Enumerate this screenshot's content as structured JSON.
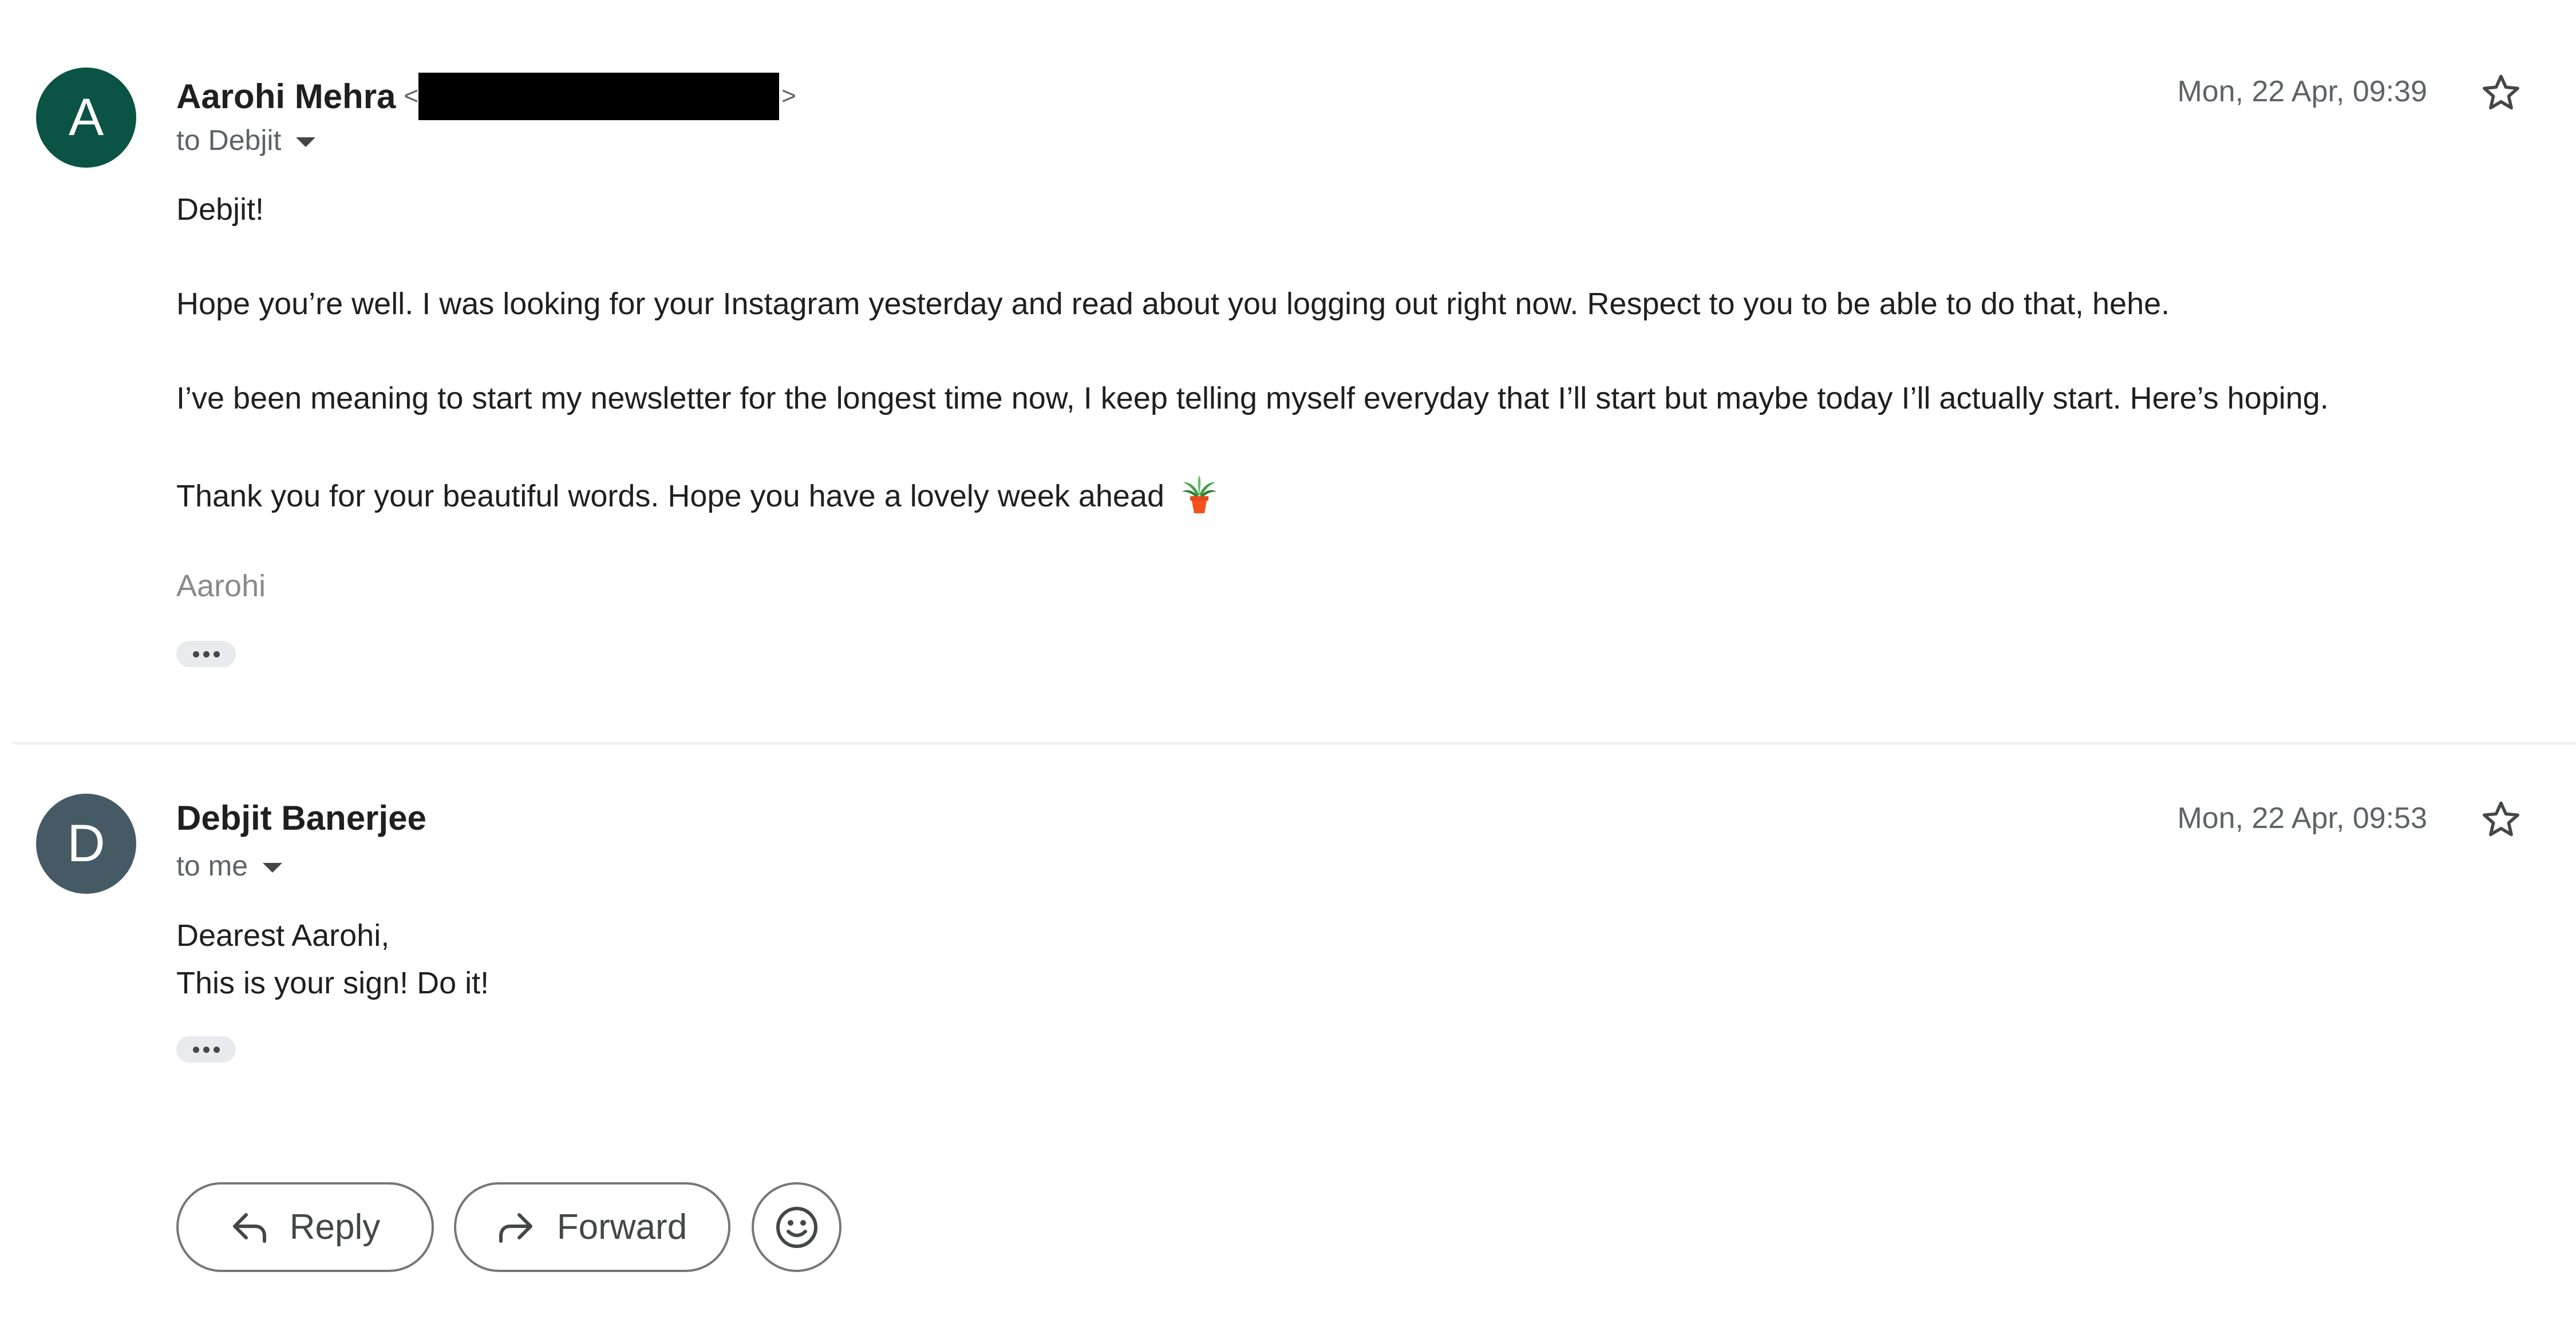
{
  "messages": [
    {
      "avatar_letter": "A",
      "sender_name": "Aarohi Mehra",
      "email_open": "<",
      "email_close": ">",
      "recipient_line": "to Debjit",
      "timestamp": "Mon, 22 Apr, 09:39",
      "body": [
        "Debjit!",
        "Hope you’re well. I was looking for your Instagram yesterday and read about you logging out right now. Respect to you to be able to do that, hehe.",
        "I’ve been meaning to start my newsletter for the longest time now, I keep telling myself everyday that I’ll start but maybe today I’ll actually start. Here’s hoping.",
        "Thank you for your beautiful words. Hope you have a lovely week ahead"
      ],
      "signature": "Aarohi"
    },
    {
      "avatar_letter": "D",
      "sender_name": "Debjit Banerjee",
      "recipient_line": "to me",
      "timestamp": "Mon, 22 Apr, 09:53",
      "body": [
        "Dearest Aarohi,",
        "This is your sign! Do it!"
      ]
    }
  ],
  "actions": {
    "reply_label": "Reply",
    "forward_label": "Forward"
  },
  "icons": {
    "star": "star-outline-icon",
    "caret": "caret-down-icon",
    "more": "more-horizontal-icon",
    "reply": "reply-arrow-icon",
    "forward": "forward-arrow-icon",
    "emoji": "smiley-face-icon",
    "plant": "potted-plant-emoji"
  },
  "colors": {
    "avatar_a": "#0b5345",
    "avatar_d": "#455a64",
    "text": "#1f1f1f",
    "muted": "#5f6368",
    "button_border": "#747775"
  }
}
